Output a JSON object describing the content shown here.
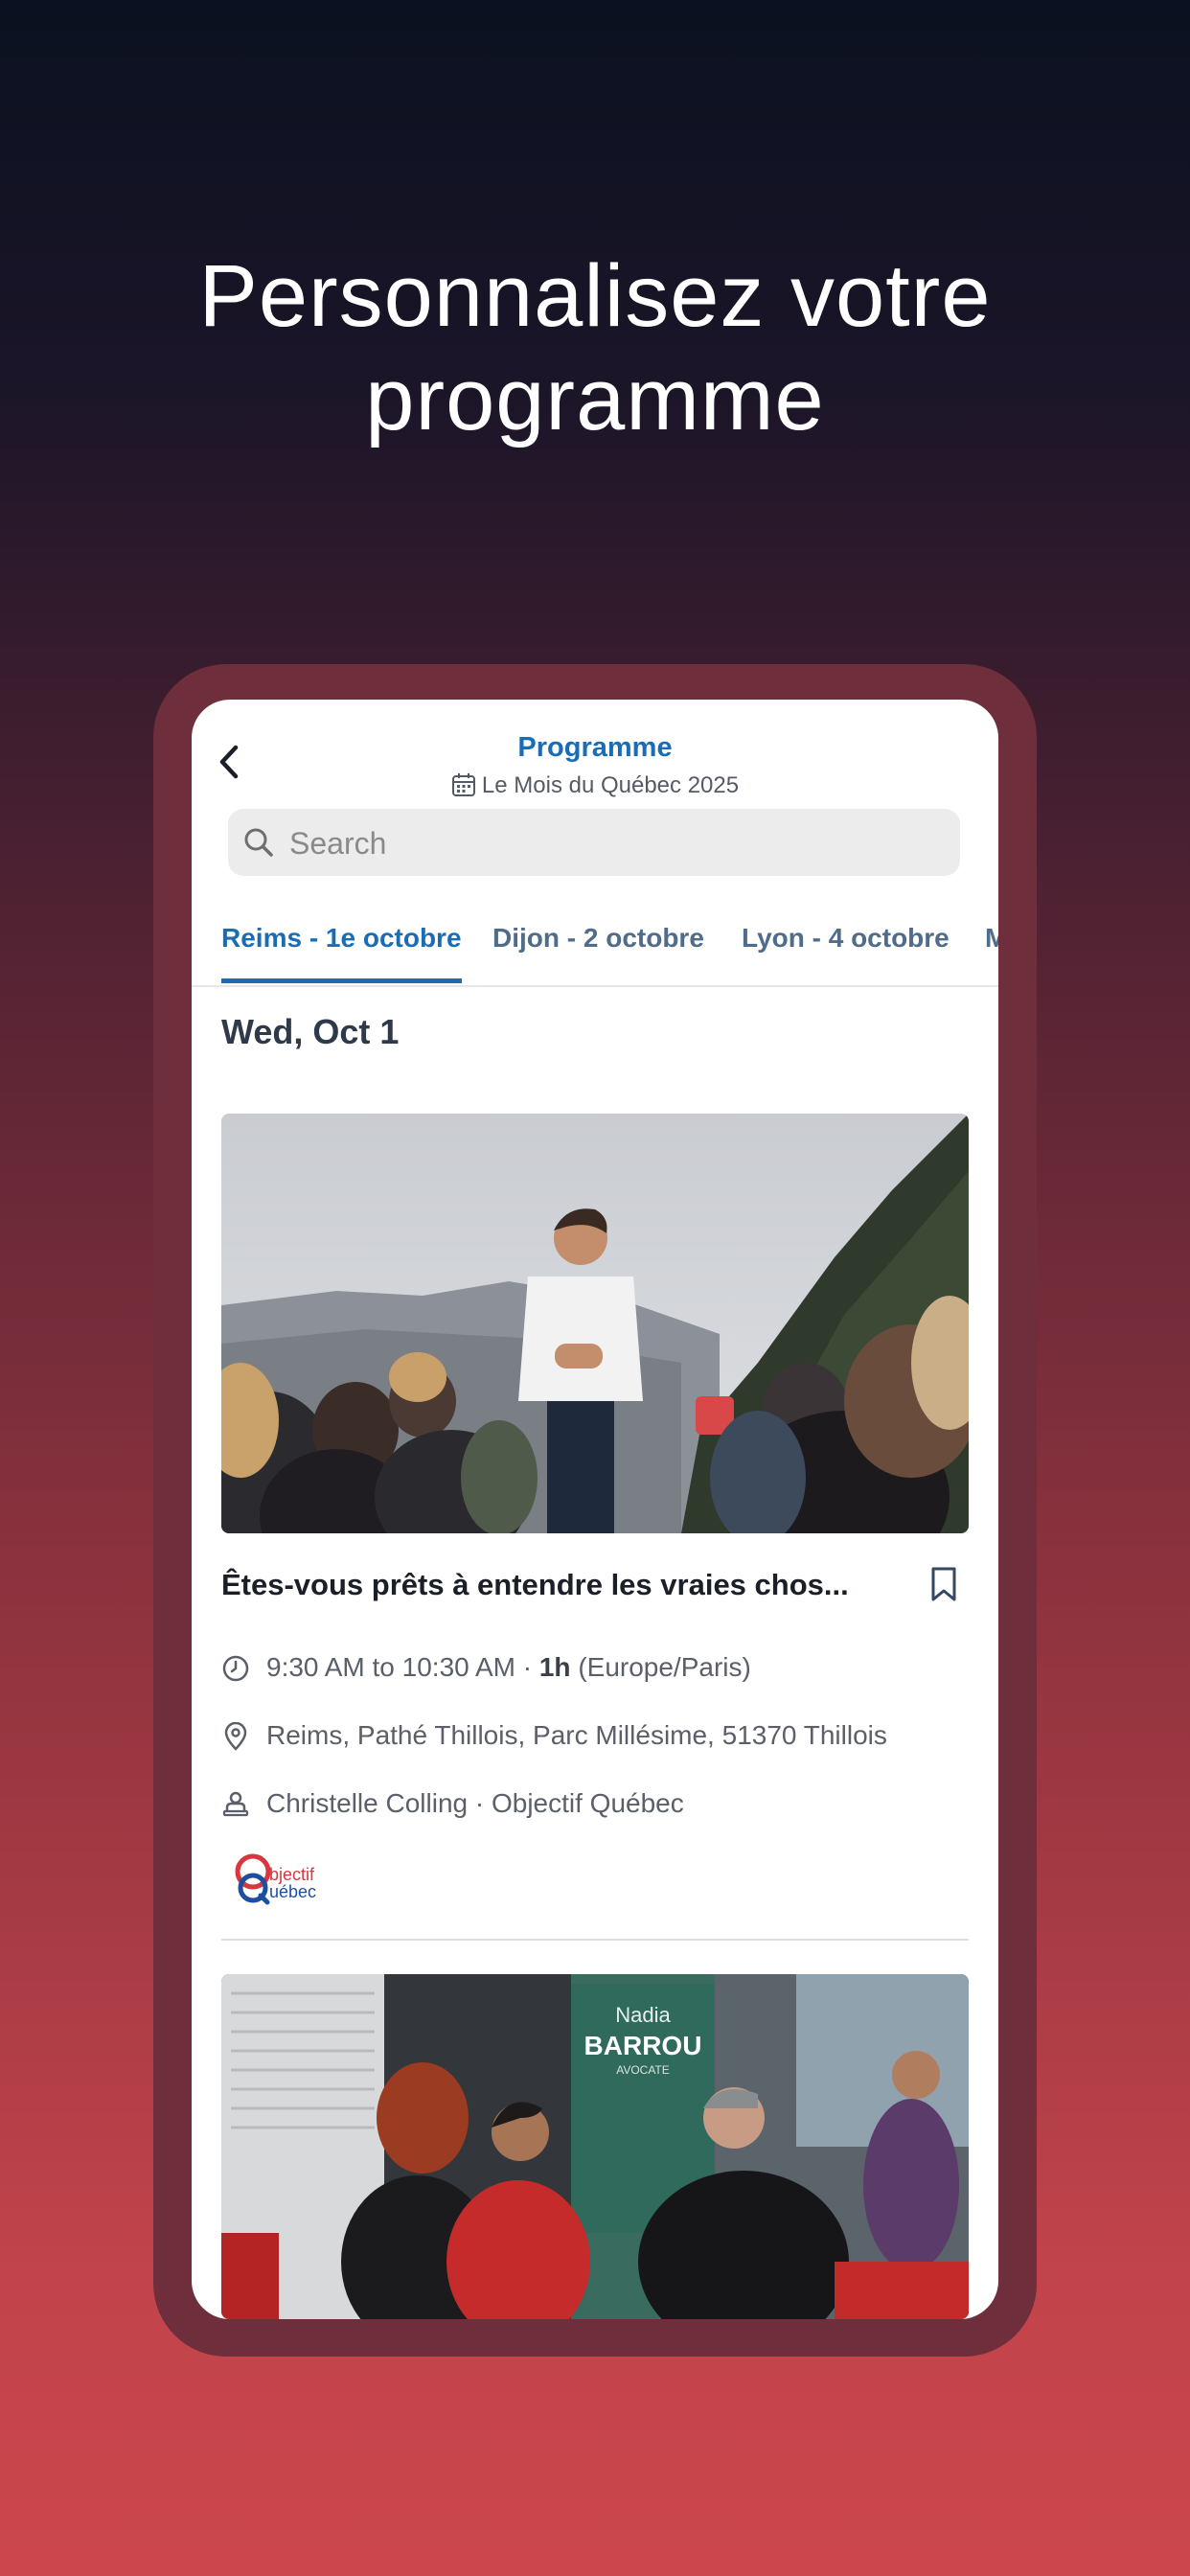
{
  "headline": {
    "line1": "Personnalisez votre",
    "line2": "programme"
  },
  "header": {
    "title": "Programme",
    "subtitle": "Le Mois du Québec 2025"
  },
  "search": {
    "placeholder": "Search"
  },
  "tabs": [
    {
      "label": "Reims - 1e octobre",
      "active": true
    },
    {
      "label": "Dijon - 2 octobre",
      "active": false
    },
    {
      "label": "Lyon - 4 octobre",
      "active": false
    },
    {
      "label": "M",
      "active": false
    }
  ],
  "day_heading": "Wed, Oct 1",
  "event": {
    "title": "Êtes-vous prêts à entendre les vraies chos...",
    "time": "9:30 AM to 10:30 AM",
    "separator": "·",
    "duration": "1h",
    "timezone": "(Europe/Paris)",
    "location": "Reims, Pathé Thillois, Parc Millésime, 51370 Thillois",
    "speaker": "Christelle Colling · Objectif Québec",
    "logo_text": {
      "word1": "bjectif",
      "word2": "uébec"
    }
  },
  "photo2_sign": {
    "line1": "Nadia",
    "line2": "BARROU",
    "line3": "AVOCATE"
  },
  "colors": {
    "accent": "#1a6db5",
    "tab_inactive": "#4f6c8a",
    "frame": "#6e2e3b"
  },
  "icons": [
    "back-chevron-icon",
    "calendar-icon",
    "search-icon",
    "bookmark-icon",
    "clock-icon",
    "location-pin-icon",
    "speaker-icon"
  ]
}
